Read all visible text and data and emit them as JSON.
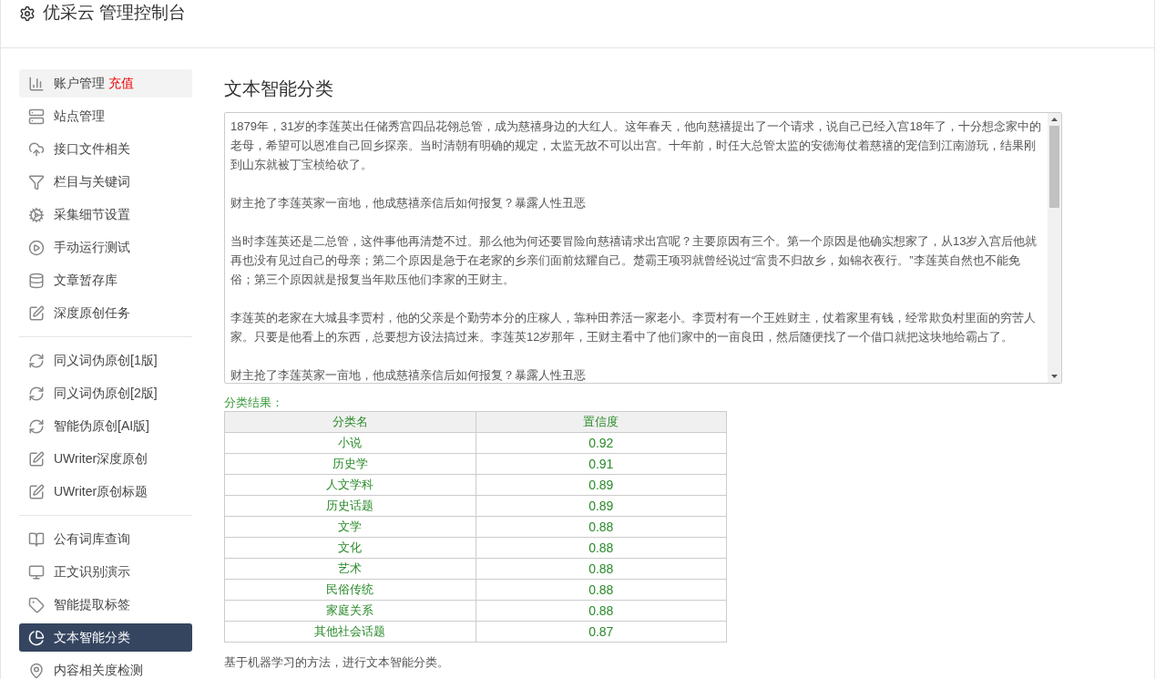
{
  "header": {
    "title": "优采云 管理控制台"
  },
  "sidebar": {
    "groups": [
      {
        "items": [
          {
            "label": "账户管理",
            "badge": "充值",
            "highlighted": true,
            "selected": false
          },
          {
            "label": "站点管理",
            "highlighted": false,
            "selected": false
          },
          {
            "label": "接口文件相关",
            "highlighted": false,
            "selected": false
          },
          {
            "label": "栏目与关键词",
            "highlighted": false,
            "selected": false
          },
          {
            "label": "采集细节设置",
            "highlighted": false,
            "selected": false
          },
          {
            "label": "手动运行测试",
            "highlighted": false,
            "selected": false
          },
          {
            "label": "文章暂存库",
            "highlighted": false,
            "selected": false
          },
          {
            "label": "深度原创任务",
            "highlighted": false,
            "selected": false
          }
        ]
      },
      {
        "items": [
          {
            "label": "同义词伪原创[1版]",
            "highlighted": false,
            "selected": false
          },
          {
            "label": "同义词伪原创[2版]",
            "highlighted": false,
            "selected": false
          },
          {
            "label": "智能伪原创[AI版]",
            "highlighted": false,
            "selected": false
          },
          {
            "label": "UWriter深度原创",
            "highlighted": false,
            "selected": false
          },
          {
            "label": "UWriter原创标题",
            "highlighted": false,
            "selected": false
          }
        ]
      },
      {
        "items": [
          {
            "label": "公有词库查询",
            "highlighted": false,
            "selected": false
          },
          {
            "label": "正文识别演示",
            "highlighted": false,
            "selected": false
          },
          {
            "label": "智能提取标签",
            "highlighted": false,
            "selected": false
          },
          {
            "label": "文本智能分类",
            "highlighted": false,
            "selected": true
          },
          {
            "label": "内容相关度检测",
            "highlighted": false,
            "selected": false
          }
        ]
      }
    ]
  },
  "main": {
    "title": "文本智能分类",
    "text_area": {
      "paragraphs": [
        "1879年，31岁的李莲英出任储秀宫四品花翎总管，成为慈禧身边的大红人。这年春天，他向慈禧提出了一个请求，说自己已经入宫18年了，十分想念家中的老母，希望可以恩准自己回乡探亲。当时清朝有明确的规定，太监无故不可以出宫。十年前，时任大总管太监的安德海仗着慈禧的宠信到江南游玩，结果刚到山东就被丁宝桢给砍了。",
        "财主抢了李莲英家一亩地，他成慈禧亲信后如何报复？暴露人性丑恶",
        "当时李莲英还是二总管，这件事他再清楚不过。那么他为何还要冒险向慈禧请求出宫呢？主要原因有三个。第一个原因是他确实想家了，从13岁入宫后他就再也没有见过自己的母亲；第二个原因是急于在老家的乡亲们面前炫耀自己。楚霸王项羽就曾经说过“富贵不归故乡，如锦衣夜行。”李莲英自然也不能免俗；第三个原因就是报复当年欺压他们李家的王财主。",
        "李莲英的老家在大城县李贾村，他的父亲是个勤劳本分的庄稼人，靠种田养活一家老小。李贾村有一个王姓财主，仗着家里有钱，经常欺负村里面的穷苦人家。只要是他看上的东西，总要想方设法搞过来。李莲英12岁那年，王财主看中了他们家中的一亩良田，然后随便找了一个借口就把这块地给霸占了。",
        "财主抢了李莲英家一亩地，他成慈禧亲信后如何报复？暴露人性丑恶"
      ]
    },
    "result_label": "分类结果：",
    "table": {
      "columns": [
        "分类名",
        "置信度"
      ],
      "rows": [
        [
          "小说",
          "0.92"
        ],
        [
          "历史学",
          "0.91"
        ],
        [
          "人文学科",
          "0.89"
        ],
        [
          "历史话题",
          "0.89"
        ],
        [
          "文学",
          "0.88"
        ],
        [
          "文化",
          "0.88"
        ],
        [
          "艺术",
          "0.88"
        ],
        [
          "民俗传统",
          "0.88"
        ],
        [
          "家庭关系",
          "0.88"
        ],
        [
          "其他社会话题",
          "0.87"
        ]
      ]
    },
    "footer_note": "基于机器学习的方法，进行文本智能分类。"
  }
}
